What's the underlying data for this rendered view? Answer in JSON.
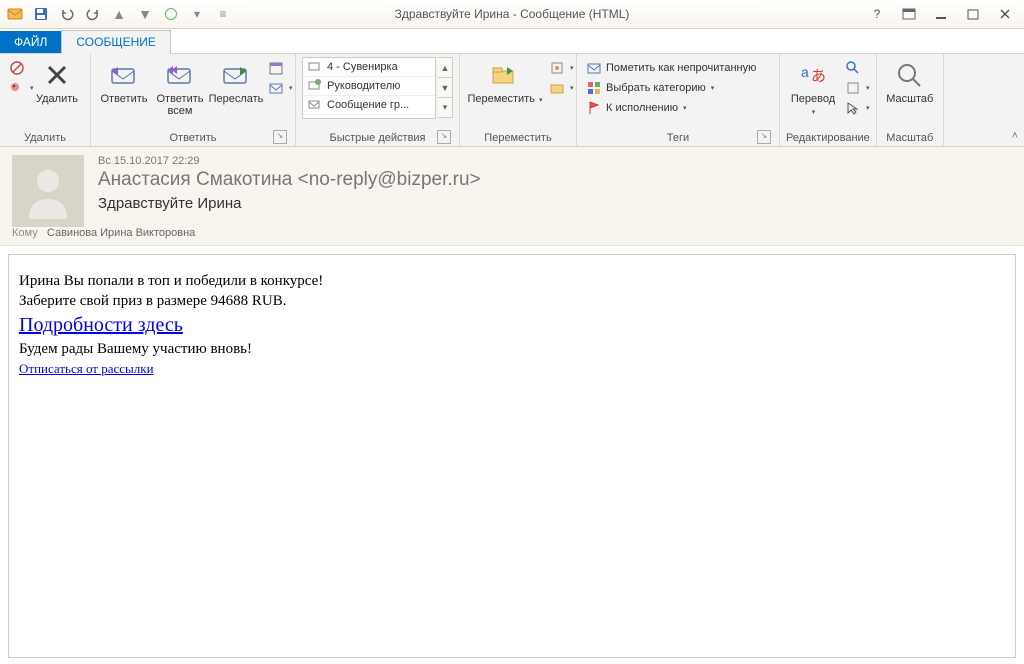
{
  "window": {
    "title": "Здравствуйте Ирина - Сообщение (HTML)"
  },
  "tabs": {
    "file": "ФАЙЛ",
    "message": "СООБЩЕНИЕ"
  },
  "ribbon": {
    "delete_group": {
      "label": "Удалить",
      "delete": "Удалить"
    },
    "respond_group": {
      "label": "Ответить",
      "reply": "Ответить",
      "reply_all": "Ответить\nвсем",
      "forward": "Переслать"
    },
    "quick_group": {
      "label": "Быстрые действия",
      "r1": "4 - Сувенирка",
      "r2": "Руководителю",
      "r3": "Сообщение гр..."
    },
    "move_group": {
      "label": "Переместить",
      "move": "Переместить"
    },
    "tags_group": {
      "label": "Теги",
      "unread": "Пометить как непрочитанную",
      "category": "Выбрать категорию",
      "followup": "К исполнению"
    },
    "edit_group": {
      "label": "Редактирование",
      "translate": "Перевод"
    },
    "zoom_group": {
      "label": "Масштаб",
      "zoom": "Масштаб"
    }
  },
  "mail": {
    "date": "Вс 15.10.2017 22:29",
    "from": "Анастасия Смакотина <no-reply@bizper.ru>",
    "subject": "Здравствуйте Ирина",
    "to_label": "Кому",
    "to_value": "Савинова Ирина Викторовна",
    "body": {
      "l1": "Ирина Вы попали в топ и победили в конкурсе!",
      "l2": "Заберите свой приз в размере 94688 RUB.",
      "link1": "Подробности здесь",
      "l3": "Будем рады Вашему участию вновь!",
      "link2": "Отписаться от рассылки"
    }
  }
}
